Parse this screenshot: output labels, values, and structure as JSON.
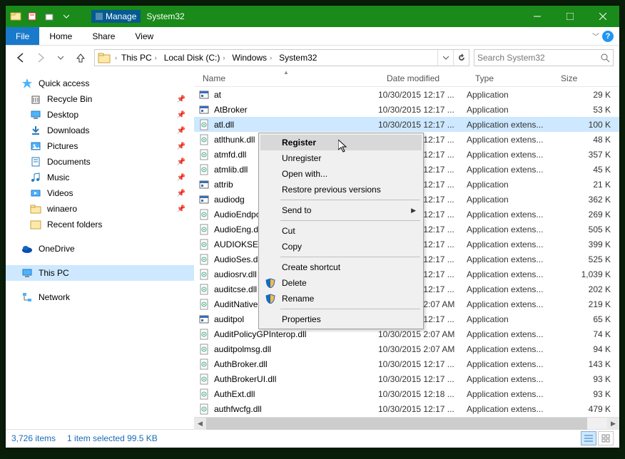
{
  "titlebar": {
    "ribbon_label": "Manage",
    "window_title": "System32"
  },
  "tabs": {
    "file": "File",
    "home": "Home",
    "share": "Share",
    "view": "View"
  },
  "breadcrumb": [
    "This PC",
    "Local Disk (C:)",
    "Windows",
    "System32"
  ],
  "search": {
    "placeholder": "Search System32"
  },
  "nav": {
    "quick_access": "Quick access",
    "pinned": [
      {
        "icon": "recycle",
        "label": "Recycle Bin"
      },
      {
        "icon": "desktop",
        "label": "Desktop"
      },
      {
        "icon": "download",
        "label": "Downloads"
      },
      {
        "icon": "pictures",
        "label": "Pictures"
      },
      {
        "icon": "documents",
        "label": "Documents"
      },
      {
        "icon": "music",
        "label": "Music"
      },
      {
        "icon": "videos",
        "label": "Videos"
      },
      {
        "icon": "folder",
        "label": "winaero"
      }
    ],
    "recent": "Recent folders",
    "onedrive": "OneDrive",
    "thispc": "This PC",
    "network": "Network"
  },
  "cols": {
    "name": "Name",
    "date": "Date modified",
    "type": "Type",
    "size": "Size"
  },
  "files": [
    {
      "icon": "exe",
      "name": "at",
      "date": "10/30/2015 12:17 ...",
      "type": "Application",
      "size": "29 K"
    },
    {
      "icon": "exe",
      "name": "AtBroker",
      "date": "10/30/2015 12:17 ...",
      "type": "Application",
      "size": "53 K"
    },
    {
      "icon": "dll",
      "name": "atl.dll",
      "date": "10/30/2015 12:17 ...",
      "type": "Application extens...",
      "size": "100 K",
      "selected": true
    },
    {
      "icon": "dll",
      "name": "atlthunk.dll",
      "date": "10/30/2015 12:17 ...",
      "type": "Application extens...",
      "size": "48 K"
    },
    {
      "icon": "dll",
      "name": "atmfd.dll",
      "date": "10/30/2015 12:17 ...",
      "type": "Application extens...",
      "size": "357 K"
    },
    {
      "icon": "dll",
      "name": "atmlib.dll",
      "date": "10/30/2015 12:17 ...",
      "type": "Application extens...",
      "size": "45 K"
    },
    {
      "icon": "exe",
      "name": "attrib",
      "date": "10/30/2015 12:17 ...",
      "type": "Application",
      "size": "21 K"
    },
    {
      "icon": "exe",
      "name": "audiodg",
      "date": "10/30/2015 12:17 ...",
      "type": "Application",
      "size": "362 K"
    },
    {
      "icon": "dll",
      "name": "AudioEndpoi...",
      "date": "10/30/2015 12:17 ...",
      "type": "Application extens...",
      "size": "269 K"
    },
    {
      "icon": "dll",
      "name": "AudioEng.dll",
      "date": "10/30/2015 12:17 ...",
      "type": "Application extens...",
      "size": "505 K"
    },
    {
      "icon": "dll",
      "name": "AUDIOKSE.dll",
      "date": "10/30/2015 12:17 ...",
      "type": "Application extens...",
      "size": "399 K"
    },
    {
      "icon": "dll",
      "name": "AudioSes.dll",
      "date": "10/30/2015 12:17 ...",
      "type": "Application extens...",
      "size": "525 K"
    },
    {
      "icon": "dll",
      "name": "audiosrv.dll",
      "date": "10/30/2015 12:17 ...",
      "type": "Application extens...",
      "size": "1,039 K"
    },
    {
      "icon": "dll",
      "name": "auditcse.dll",
      "date": "10/30/2015 12:17 ...",
      "type": "Application extens...",
      "size": "202 K"
    },
    {
      "icon": "dll",
      "name": "AuditNative...",
      "date": "10/30/2015 2:07 AM",
      "type": "Application extens...",
      "size": "219 K"
    },
    {
      "icon": "exe",
      "name": "auditpol",
      "date": "10/30/2015 12:17 ...",
      "type": "Application",
      "size": "65 K"
    },
    {
      "icon": "dll",
      "name": "AuditPolicyGPInterop.dll",
      "date": "10/30/2015 2:07 AM",
      "type": "Application extens...",
      "size": "74 K"
    },
    {
      "icon": "dll",
      "name": "auditpolmsg.dll",
      "date": "10/30/2015 2:07 AM",
      "type": "Application extens...",
      "size": "94 K"
    },
    {
      "icon": "dll",
      "name": "AuthBroker.dll",
      "date": "10/30/2015 12:17 ...",
      "type": "Application extens...",
      "size": "143 K"
    },
    {
      "icon": "dll",
      "name": "AuthBrokerUI.dll",
      "date": "10/30/2015 12:17 ...",
      "type": "Application extens...",
      "size": "93 K"
    },
    {
      "icon": "dll",
      "name": "AuthExt.dll",
      "date": "10/30/2015 12:18 ...",
      "type": "Application extens...",
      "size": "93 K"
    },
    {
      "icon": "dll",
      "name": "authfwcfg.dll",
      "date": "10/30/2015 12:17 ...",
      "type": "Application extens...",
      "size": "479 K"
    }
  ],
  "ctxmenu": [
    {
      "label": "Register",
      "bold": true,
      "hover": true
    },
    {
      "label": "Unregister"
    },
    {
      "label": "Open with..."
    },
    {
      "label": "Restore previous versions"
    },
    {
      "sep": true
    },
    {
      "label": "Send to",
      "arrow": true
    },
    {
      "sep": true
    },
    {
      "label": "Cut"
    },
    {
      "label": "Copy"
    },
    {
      "sep": true
    },
    {
      "label": "Create shortcut"
    },
    {
      "label": "Delete",
      "icon": "shield"
    },
    {
      "label": "Rename",
      "icon": "shield"
    },
    {
      "sep": true
    },
    {
      "label": "Properties"
    }
  ],
  "status": {
    "items": "3,726 items",
    "selection": "1 item selected  99.5 KB"
  }
}
